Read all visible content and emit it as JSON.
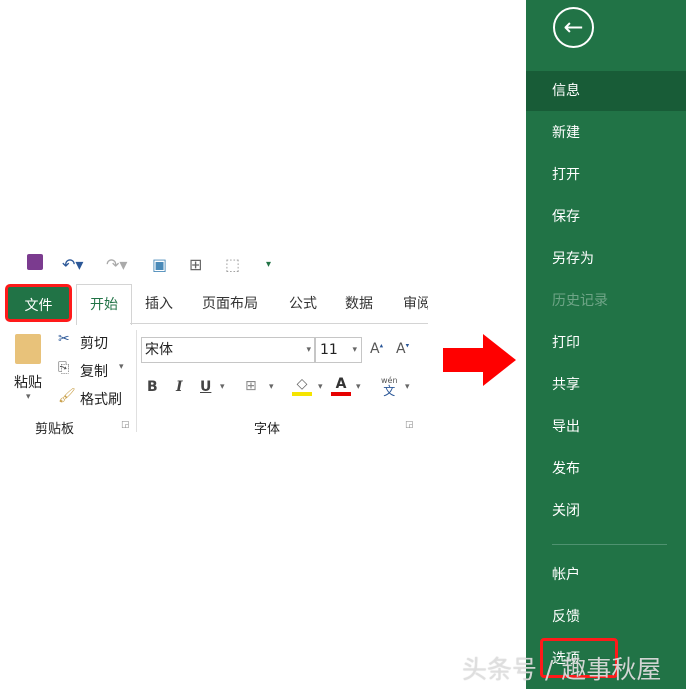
{
  "ribbon": {
    "tabs": [
      "文件",
      "开始",
      "插入",
      "页面布局",
      "公式",
      "数据",
      "审阅"
    ],
    "clipboard": {
      "paste": "粘贴",
      "cut": "剪切",
      "copy": "复制",
      "format_painter": "格式刷",
      "group_label": "剪贴板"
    },
    "font": {
      "name": "宋体",
      "size": "11",
      "bold": "B",
      "italic": "I",
      "underline": "U",
      "font_color": "A",
      "phonetic_top": "wén",
      "phonetic_bottom": "文",
      "group_label": "字体"
    }
  },
  "backstage": {
    "items": [
      "信息",
      "新建",
      "打开",
      "保存",
      "另存为",
      "历史记录",
      "打印",
      "共享",
      "导出",
      "发布",
      "关闭"
    ],
    "bottom_items": [
      "帐户",
      "反馈",
      "选项"
    ],
    "selected": "信息",
    "disabled": "历史记录"
  },
  "watermark": "头条号 / 趣事秋屋",
  "colors": {
    "excel_green": "#217346",
    "selected": "#185c37",
    "highlight_red": "#ff1a1a"
  }
}
